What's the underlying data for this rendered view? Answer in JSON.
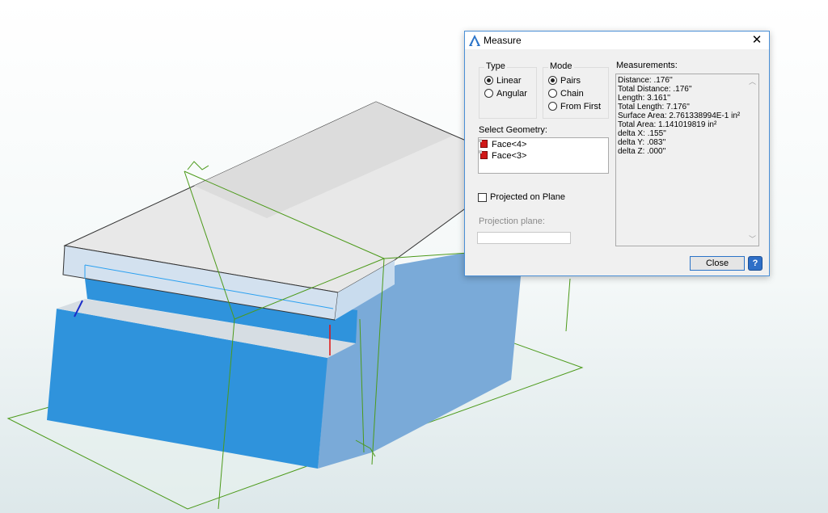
{
  "dialog": {
    "title": "Measure",
    "close_glyph": "✕",
    "type_group": {
      "label": "Type",
      "options": [
        {
          "label": "Linear",
          "selected": true
        },
        {
          "label": "Angular",
          "selected": false
        }
      ]
    },
    "mode_group": {
      "label": "Mode",
      "options": [
        {
          "label": "Pairs",
          "selected": true
        },
        {
          "label": "Chain",
          "selected": false
        },
        {
          "label": "From First",
          "selected": false
        }
      ]
    },
    "select_geometry": {
      "label": "Select Geometry:",
      "items": [
        "Face<4>",
        "Face<3>"
      ]
    },
    "projected_on_plane": {
      "label": "Projected on Plane",
      "checked": false
    },
    "projection_plane": {
      "label": "Projection plane:",
      "value": ""
    },
    "measurements": {
      "label": "Measurements:",
      "lines": [
        "Distance: .176''",
        "Total Distance: .176''",
        "Length: 3.161''",
        "Total Length: 7.176''",
        "Surface Area: 2.761338994E-1 in²",
        "Total Area: 1.141019819 in²",
        "delta X: .155''",
        "delta Y: .083''",
        "delta Z: .000''"
      ]
    },
    "close_button": "Close",
    "help_button": "?"
  },
  "colors": {
    "face_blue": "#3a9be0",
    "face_side_blue": "#7aaad8",
    "top_grey": "#e6e6e6",
    "front_plate": "#d8e3ee",
    "construction_green": "#4c9a1a",
    "dialog_border": "#4a8fd6"
  },
  "icons": [
    "app-logo-icon",
    "close-icon",
    "face-icon",
    "help-icon",
    "scroll-up-icon",
    "scroll-down-icon"
  ]
}
